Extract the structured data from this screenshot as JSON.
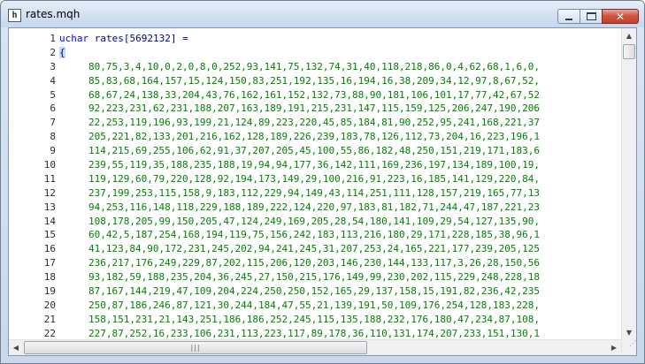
{
  "window": {
    "title": "rates.mqh",
    "app_icon_glyph": "h",
    "buttons": {
      "minimize": "minimize-icon",
      "maximize": "maximize-icon",
      "close": "close-icon"
    }
  },
  "editor": {
    "colors": {
      "keyword": "#0000ff",
      "identifier": "#000080",
      "number": "#008000"
    },
    "lines": [
      {
        "n": "1",
        "kw": "uchar",
        "text": " rates[5692132] ="
      },
      {
        "n": "2",
        "brace": "{"
      },
      {
        "n": "3",
        "nums": "80,75,3,4,10,0,2,0,8,0,252,93,141,75,132,74,31,40,118,218,86,0,4,62,68,1,6,0,"
      },
      {
        "n": "4",
        "nums": "85,83,68,164,157,15,124,150,83,251,192,135,16,194,16,38,209,34,12,97,8,67,52,"
      },
      {
        "n": "5",
        "nums": "68,67,24,138,33,204,43,76,162,161,152,132,73,88,90,181,106,101,17,77,42,67,52"
      },
      {
        "n": "6",
        "nums": "92,223,231,62,231,188,207,163,189,191,215,231,147,115,159,125,206,247,190,206"
      },
      {
        "n": "7",
        "nums": "22,253,119,196,93,199,21,124,89,223,220,45,85,184,81,90,252,95,241,168,221,37"
      },
      {
        "n": "8",
        "nums": "205,221,82,133,201,216,162,128,189,226,239,183,78,126,112,73,204,16,223,196,1"
      },
      {
        "n": "9",
        "nums": "114,215,69,255,106,62,91,37,207,205,45,100,55,86,182,48,250,151,219,171,183,6"
      },
      {
        "n": "10",
        "nums": "239,55,119,35,188,235,188,19,94,94,177,36,142,111,169,236,197,134,189,100,19,"
      },
      {
        "n": "11",
        "nums": "119,129,60,79,220,128,92,194,173,149,29,100,216,91,223,16,185,141,129,220,84,"
      },
      {
        "n": "12",
        "nums": "237,199,253,115,158,9,183,112,229,94,149,43,114,251,111,128,157,219,165,77,13"
      },
      {
        "n": "13",
        "nums": "94,253,116,148,118,229,188,189,222,124,220,97,183,81,182,71,244,47,187,221,23"
      },
      {
        "n": "14",
        "nums": "108,178,205,99,150,205,47,124,249,169,205,28,54,180,141,109,29,54,127,135,90,"
      },
      {
        "n": "15",
        "nums": "60,42,5,187,254,168,194,119,75,156,242,183,113,216,180,29,171,228,185,38,96,1"
      },
      {
        "n": "16",
        "nums": "41,123,84,90,172,231,245,202,94,241,245,31,207,253,24,165,221,177,239,205,125"
      },
      {
        "n": "17",
        "nums": "236,217,176,249,229,87,202,115,206,120,203,146,230,144,133,117,3,26,28,150,56"
      },
      {
        "n": "18",
        "nums": "93,182,59,188,235,204,36,245,27,150,215,176,149,99,230,202,115,229,248,228,18"
      },
      {
        "n": "19",
        "nums": "87,167,144,219,47,109,204,224,250,250,152,165,29,137,158,15,191,82,236,42,235"
      },
      {
        "n": "20",
        "nums": "250,87,186,246,87,121,30,244,184,47,55,21,139,191,50,109,176,254,128,183,228,"
      },
      {
        "n": "21",
        "nums": "158,151,231,21,143,251,186,186,252,245,115,135,188,232,176,180,47,234,87,108,"
      },
      {
        "n": "22",
        "nums": "227,87,252,16,233,106,231,113,223,117,89,178,36,110,131,174,207,233,151,130,1"
      }
    ]
  }
}
